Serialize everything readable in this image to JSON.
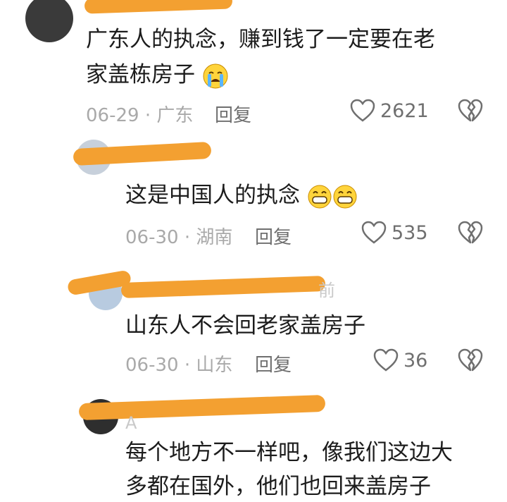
{
  "comments": [
    {
      "text_line1": "广东人的执念，赚到钱了一定要在老",
      "text_line2": "家盖栋房子",
      "emoji": "loudly-crying-face-emoji",
      "date": "06-29",
      "location": "广东",
      "reply_label": "回复",
      "likes": "2621"
    },
    {
      "text": "这是中国人的执念",
      "emoji": "grinning-face-emoji",
      "date": "06-30",
      "location": "湖南",
      "reply_label": "回复",
      "likes": "535"
    },
    {
      "faint_text": "前",
      "text": "山东人不会回老家盖房子",
      "date": "06-30",
      "location": "山东",
      "reply_label": "回复",
      "likes": "36"
    },
    {
      "faint_text": "A",
      "text_line1": "每个地方不一样吧，像我们这边大",
      "text_line2": "多都在国外，他们也回来盖房子"
    }
  ],
  "separator": " · ",
  "colors": {
    "redaction": "#f3a031",
    "meta_gray": "#a9a9a9",
    "reply_gray": "#6f6f6f"
  }
}
